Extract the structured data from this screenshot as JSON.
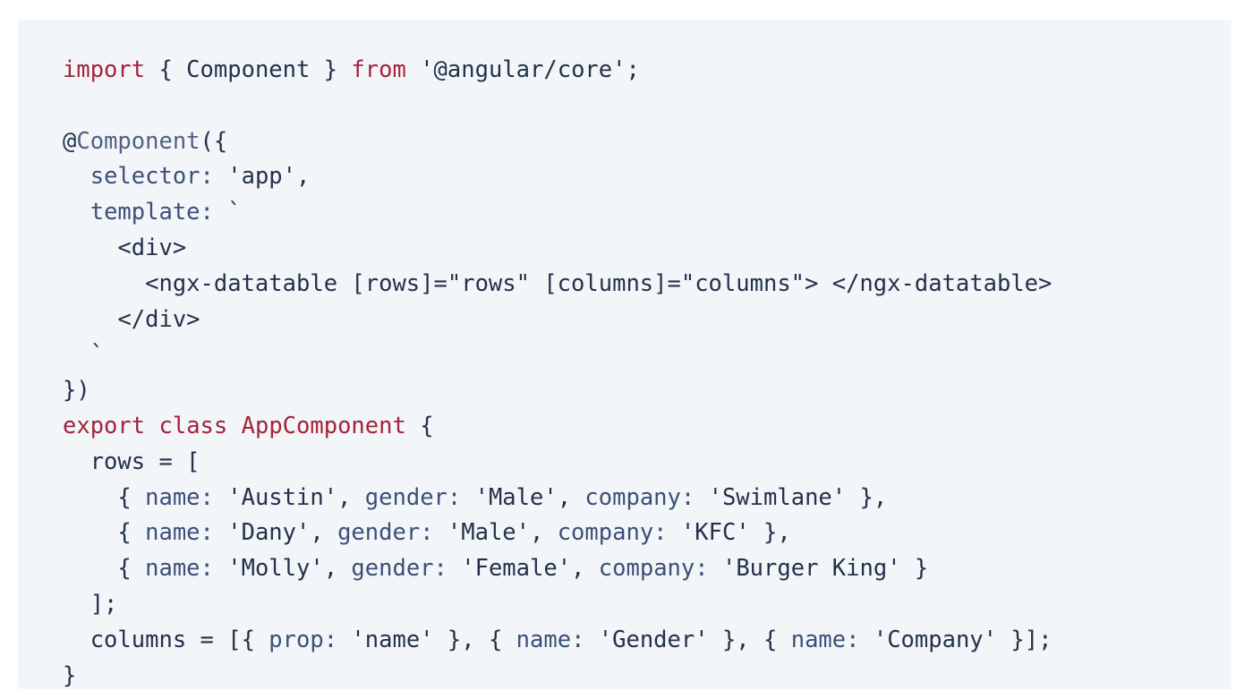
{
  "colors": {
    "background": "#ffffff",
    "code_background": "#f3f6f9",
    "plain_text": "#22314a",
    "keyword": "#a3233a",
    "property": "#3b4f78",
    "decorator": "#4f5f86"
  },
  "code_lines": [
    [
      {
        "text": "import",
        "kind": "keyword"
      },
      {
        "text": " { Component } ",
        "kind": "plain"
      },
      {
        "text": "from",
        "kind": "keyword"
      },
      {
        "text": " '@angular/core';",
        "kind": "plain"
      }
    ],
    [],
    [
      {
        "text": "@",
        "kind": "plain"
      },
      {
        "text": "Component",
        "kind": "decorator"
      },
      {
        "text": "({",
        "kind": "plain"
      }
    ],
    [
      {
        "text": "  ",
        "kind": "plain"
      },
      {
        "text": "selector:",
        "kind": "property"
      },
      {
        "text": " 'app',",
        "kind": "plain"
      }
    ],
    [
      {
        "text": "  ",
        "kind": "plain"
      },
      {
        "text": "template:",
        "kind": "property"
      },
      {
        "text": " `",
        "kind": "plain"
      }
    ],
    [
      {
        "text": "    <div>",
        "kind": "plain"
      }
    ],
    [
      {
        "text": "      <ngx-datatable [rows]=\"rows\" [columns]=\"columns\"> </ngx-datatable>",
        "kind": "plain"
      }
    ],
    [
      {
        "text": "    </div>",
        "kind": "plain"
      }
    ],
    [
      {
        "text": "  `",
        "kind": "plain"
      }
    ],
    [
      {
        "text": "})",
        "kind": "plain"
      }
    ],
    [
      {
        "text": "export",
        "kind": "keyword"
      },
      {
        "text": " ",
        "kind": "plain"
      },
      {
        "text": "class",
        "kind": "keyword"
      },
      {
        "text": " ",
        "kind": "plain"
      },
      {
        "text": "AppComponent",
        "kind": "keyword"
      },
      {
        "text": " {",
        "kind": "plain"
      }
    ],
    [
      {
        "text": "  rows = [",
        "kind": "plain"
      }
    ],
    [
      {
        "text": "    { ",
        "kind": "plain"
      },
      {
        "text": "name:",
        "kind": "property"
      },
      {
        "text": " 'Austin', ",
        "kind": "plain"
      },
      {
        "text": "gender:",
        "kind": "property"
      },
      {
        "text": " 'Male', ",
        "kind": "plain"
      },
      {
        "text": "company:",
        "kind": "property"
      },
      {
        "text": " 'Swimlane' },",
        "kind": "plain"
      }
    ],
    [
      {
        "text": "    { ",
        "kind": "plain"
      },
      {
        "text": "name:",
        "kind": "property"
      },
      {
        "text": " 'Dany', ",
        "kind": "plain"
      },
      {
        "text": "gender:",
        "kind": "property"
      },
      {
        "text": " 'Male', ",
        "kind": "plain"
      },
      {
        "text": "company:",
        "kind": "property"
      },
      {
        "text": " 'KFC' },",
        "kind": "plain"
      }
    ],
    [
      {
        "text": "    { ",
        "kind": "plain"
      },
      {
        "text": "name:",
        "kind": "property"
      },
      {
        "text": " 'Molly', ",
        "kind": "plain"
      },
      {
        "text": "gender:",
        "kind": "property"
      },
      {
        "text": " 'Female', ",
        "kind": "plain"
      },
      {
        "text": "company:",
        "kind": "property"
      },
      {
        "text": " 'Burger King' }",
        "kind": "plain"
      }
    ],
    [
      {
        "text": "  ];",
        "kind": "plain"
      }
    ],
    [
      {
        "text": "  columns = [{ ",
        "kind": "plain"
      },
      {
        "text": "prop:",
        "kind": "property"
      },
      {
        "text": " 'name' }, { ",
        "kind": "plain"
      },
      {
        "text": "name:",
        "kind": "property"
      },
      {
        "text": " 'Gender' }, { ",
        "kind": "plain"
      },
      {
        "text": "name:",
        "kind": "property"
      },
      {
        "text": " 'Company' }];",
        "kind": "plain"
      }
    ],
    [
      {
        "text": "}",
        "kind": "plain"
      }
    ]
  ]
}
